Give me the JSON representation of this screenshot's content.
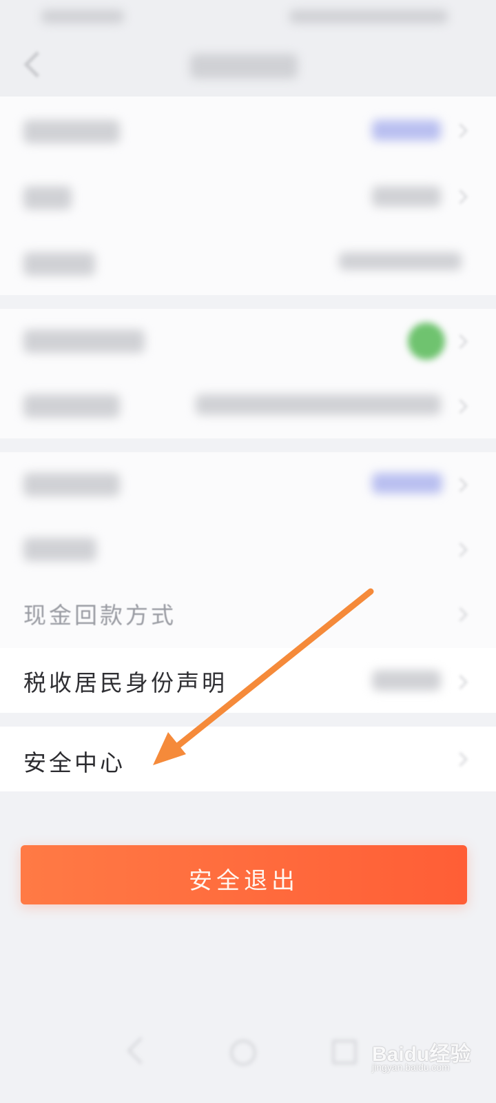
{
  "settings": {
    "rows": [
      {
        "label": "现金回款方式"
      },
      {
        "label": "税收居民身份声明"
      },
      {
        "label": "安全中心"
      }
    ]
  },
  "logout": {
    "label": "安全退出"
  },
  "watermark": {
    "text": "Baidu经验",
    "url": "jingyan.baidu.com"
  },
  "colors": {
    "background": "#f1f2f5",
    "group_background": "#fbfbfc",
    "logout_gradient_start": "#ff7a45",
    "logout_gradient_end": "#ff5e36",
    "annotation_arrow": "#f58a3a",
    "wechat_green": "#6fc36f"
  },
  "icons": [
    "back-arrow-icon",
    "wechat-icon",
    "chevron-right-icon",
    "nav-back-icon",
    "nav-home-icon",
    "nav-recents-icon"
  ]
}
